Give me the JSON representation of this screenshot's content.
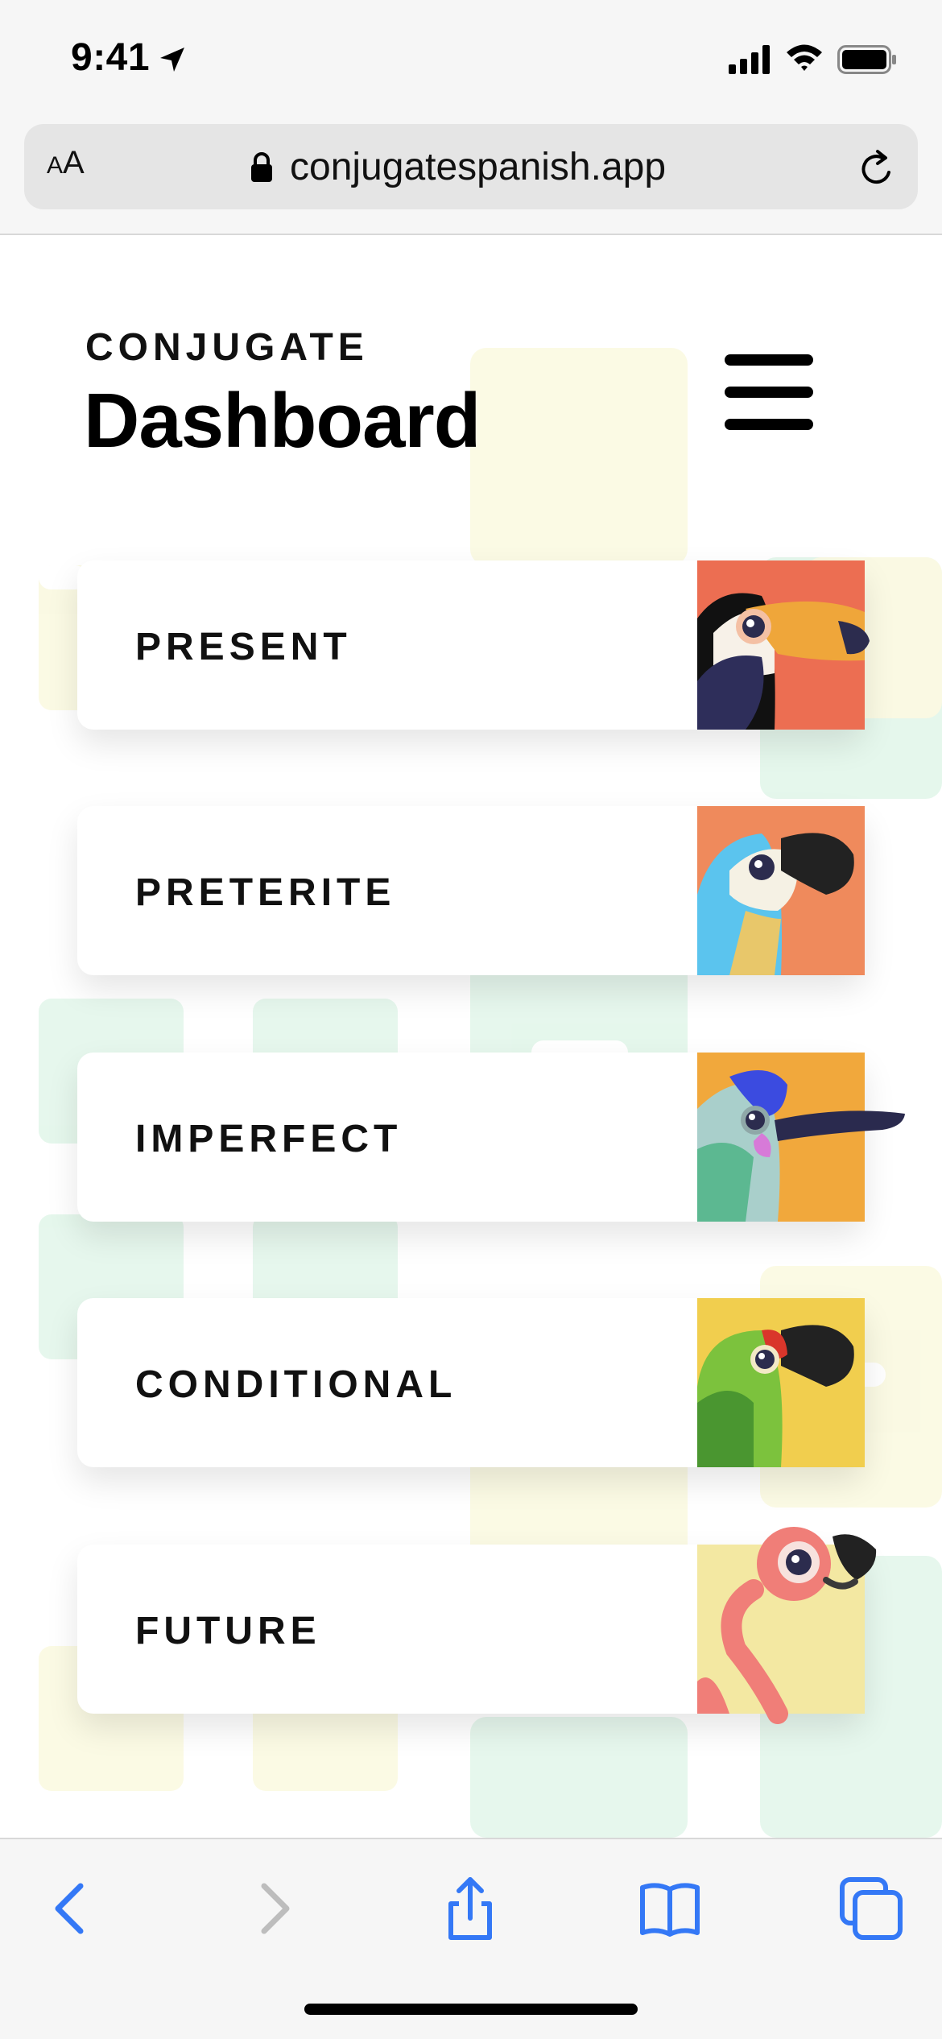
{
  "status_bar": {
    "time": "9:41"
  },
  "browser": {
    "aa_small": "A",
    "aa_large": "A",
    "url": "conjugatespanish.app"
  },
  "header": {
    "brand": "CONJUGATE",
    "title": "Dashboard"
  },
  "cards": [
    {
      "label": "PRESENT",
      "bird": "toucan",
      "color": "#EC6E52"
    },
    {
      "label": "PRETERITE",
      "bird": "parrot",
      "color": "#EF8A5C"
    },
    {
      "label": "IMPERFECT",
      "bird": "hummingbird",
      "color": "#F1A83C"
    },
    {
      "label": "CONDITIONAL",
      "bird": "green-parrot",
      "color": "#F1CE4E"
    },
    {
      "label": "FUTURE",
      "bird": "flamingo",
      "color": "#F3E8A2"
    }
  ],
  "toolbar": {
    "icons": [
      "back-icon",
      "forward-icon",
      "share-icon",
      "bookmarks-icon",
      "tabs-icon"
    ],
    "accent": "#3478F6"
  }
}
